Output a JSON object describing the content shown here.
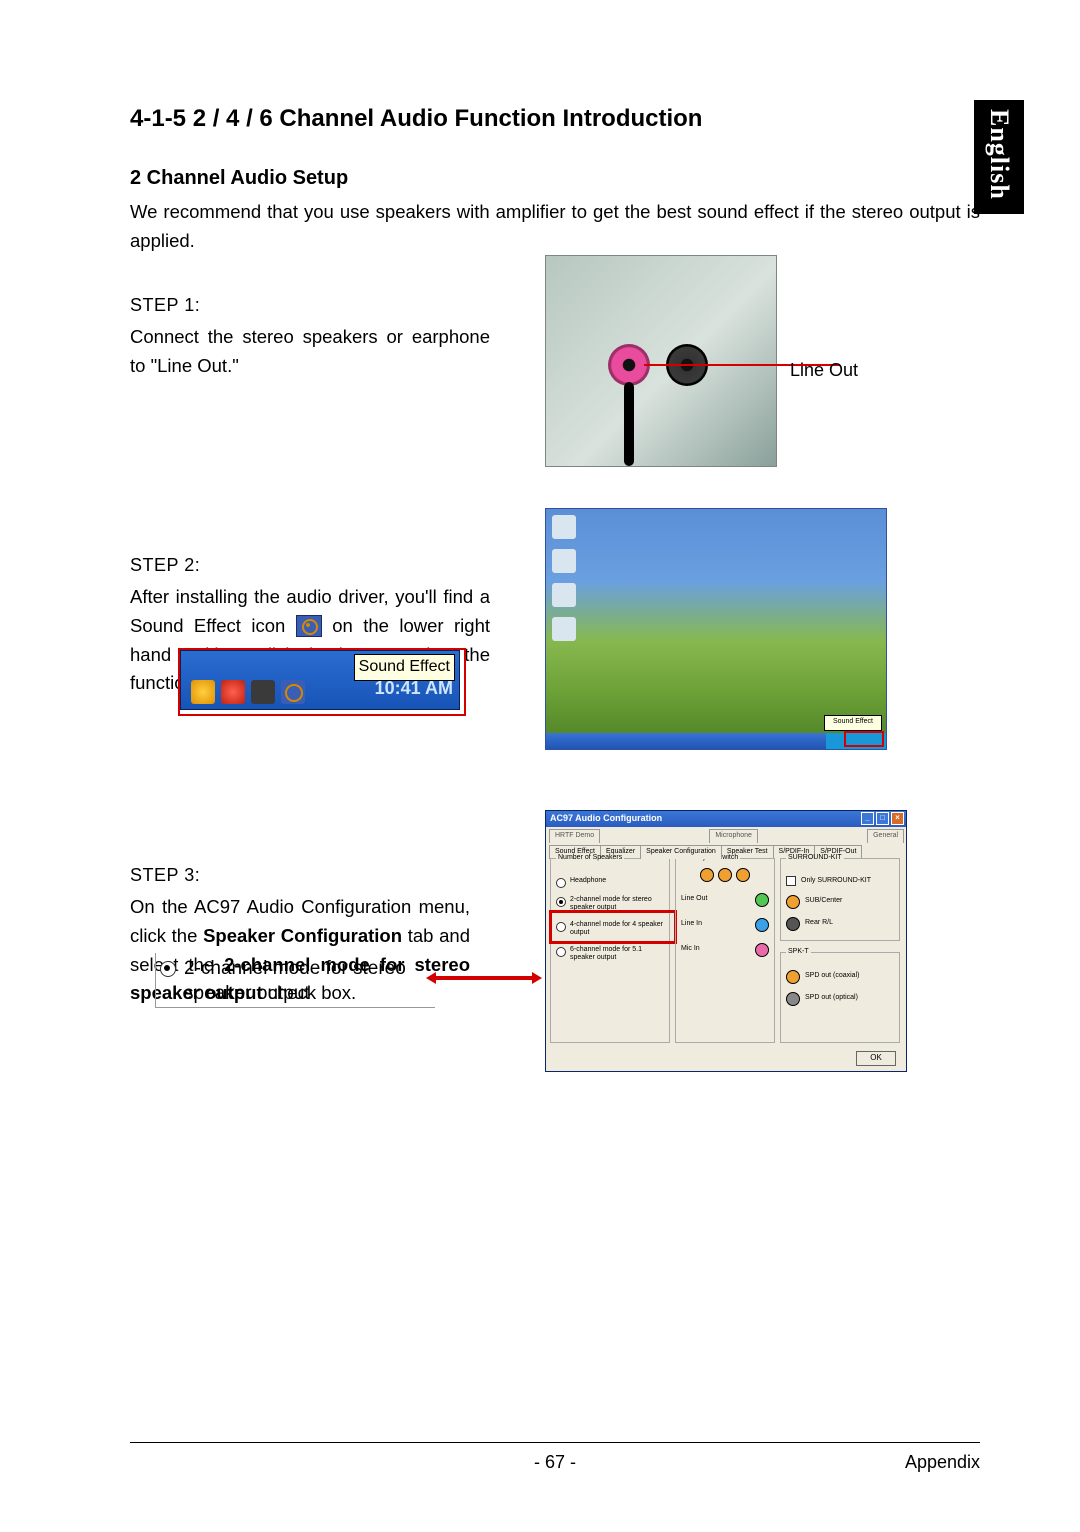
{
  "sideTab": "English",
  "heading": "4-1-5   2 / 4 / 6 Channel Audio Function Introduction",
  "subHeading": "2 Channel Audio Setup",
  "intro": "We recommend that you use speakers with amplifier to get the best sound effect if the stereo output is applied.",
  "step1": {
    "label": "STEP 1:",
    "text": "Connect the stereo speakers or earphone to \"Line Out.\"",
    "callout": "Line Out"
  },
  "step2": {
    "label": "STEP 2:",
    "text_a": "After installing the audio driver, you'll find a Sound Effect  icon ",
    "text_b": " on the lower right hand taskbar. Click the icon to select the function.",
    "tooltip": "Sound Effect",
    "balloon": "Sound Effect",
    "time": "10:41 AM"
  },
  "step3": {
    "label": "STEP 3:",
    "text_a": "On the AC97 Audio Configuration menu, click the ",
    "bold1": "Speaker Configuration",
    "text_b": " tab and select the ",
    "bold2": "2-channel mode for stereo speaker output",
    "text_c": " check box.",
    "radioLabel": "2-channel mode for stereo speaker output"
  },
  "ac97": {
    "title": "AC97 Audio Configuration",
    "tabsBack": [
      "HRTF Demo",
      "Microphone",
      "General"
    ],
    "tabsFront": [
      "Sound Effect",
      "Equalizer",
      "Speaker Configuration",
      "Speaker Test",
      "S/PDIF-In",
      "S/PDIF-Out"
    ],
    "activeTab": "Speaker Configuration",
    "groups": {
      "num": "Number of Speakers",
      "pj": "Phonejack Switch",
      "sk": "SURROUND-KIT",
      "sp": "SPK-T"
    },
    "speakerOptions": [
      {
        "label": "Headphone",
        "selected": false
      },
      {
        "label": "2-channel mode for stereo speaker output",
        "selected": true
      },
      {
        "label": "4-channel mode for 4 speaker output",
        "selected": false
      },
      {
        "label": "6-channel mode for 5.1 speaker output",
        "selected": false
      }
    ],
    "pjLabels": [
      "Line Out",
      "Line In",
      "Mic In"
    ],
    "pjColors": [
      "#53c653",
      "#3aa0e8",
      "#e86aa8"
    ],
    "skCheckbox": "Only SURROUND-KIT",
    "skItems": [
      {
        "label": "SUB/Center",
        "color": "#f0a030"
      },
      {
        "label": "Rear R/L",
        "color": "#555"
      }
    ],
    "spItems": [
      {
        "label": "SPD out (coaxial)",
        "color": "#f0a030"
      },
      {
        "label": "SPD out (optical)",
        "color": "#888"
      }
    ],
    "ok": "OK"
  },
  "footer": {
    "page": "- 67 -",
    "section": "Appendix"
  }
}
